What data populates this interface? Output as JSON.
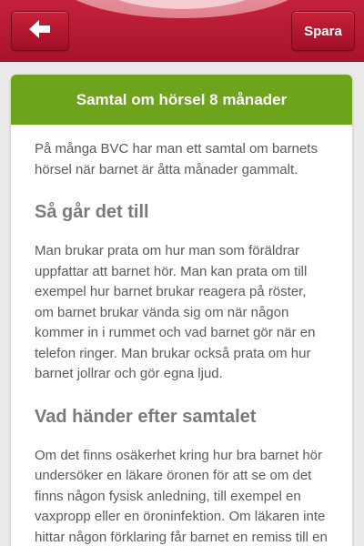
{
  "header": {
    "back_icon": "arrow-left-icon",
    "save_label": "Spara"
  },
  "card": {
    "title": "Samtal om hörsel 8 månader",
    "intro": "På många BVC har man ett samtal om barnets hörsel när barnet är åtta månader gammalt.",
    "section1": {
      "heading": "Så går det till",
      "text": "Man brukar prata om hur man som föräldrar uppfattar att barnet hör. Man kan prata om till exempel hur barnet brukar reagera på röster, om barnet brukar vända sig om när någon kommer in i rummet och vad barnet gör när en telefon ringer. Man brukar också prata om hur barnet jollrar och gör egna ljud."
    },
    "section2": {
      "heading": "Vad händer efter samtalet",
      "text": "Om det finns osäkerhet kring hur bra barnet hör undersöker en läkare öronen för att se om det finns någon fysisk anledning, till exempel en vaxpropp eller en öroninfektion. Om läkaren inte hittar någon förklaring får barnet en remiss till en"
    }
  },
  "colors": {
    "header_red": "#b41a33",
    "title_green": "#6ea31c",
    "heading_gray": "#7a7a7a",
    "text_gray": "#5a5a5a"
  }
}
